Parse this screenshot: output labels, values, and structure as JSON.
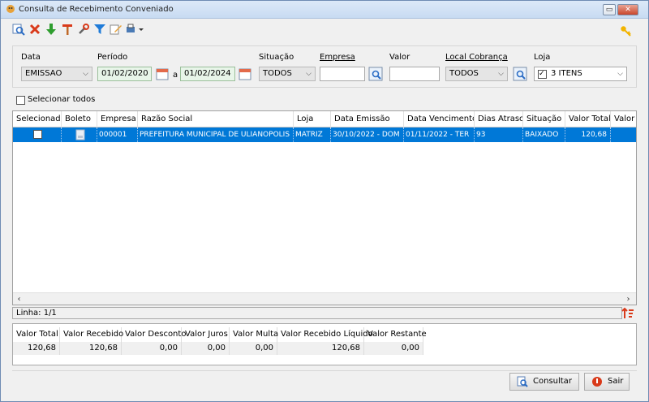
{
  "window": {
    "title": "Consulta de Recebimento Conveniado",
    "minimize": "▭",
    "close": "✕"
  },
  "filters": {
    "data_label": "Data",
    "data_value": "EMISSAO",
    "periodo_label": "Período",
    "periodo_start": "01/02/2020",
    "periodo_sep": "a",
    "periodo_end": "01/02/2024",
    "situacao_label": "Situação",
    "situacao_value": "TODOS",
    "empresa_label": "Empresa",
    "empresa_value": "",
    "valor_label": "Valor",
    "valor_value": "",
    "local_label": "Local Cobrança",
    "local_value": "TODOS",
    "loja_label": "Loja",
    "loja_value": "3 ITENS"
  },
  "select_all_label": "Selecionar todos",
  "grid": {
    "columns": [
      "Selecionado",
      "Boleto",
      "Empresa",
      "Razão Social",
      "Loja",
      "Data Emissão",
      "Data Vencimento",
      "Dias Atraso",
      "Situação",
      "Valor Total",
      "Valor"
    ],
    "rows": [
      {
        "selecionado": false,
        "empresa": "000001",
        "razao": "PREFEITURA MUNICIPAL DE ULIANOPOLIS",
        "loja": "MATRIZ",
        "emissao": "30/10/2022 - DOM",
        "vencimento": "01/11/2022 - TER",
        "dias": "93",
        "situacao": "BAIXADO",
        "valor_total": "120,68"
      }
    ]
  },
  "linha": "Linha: 1/1",
  "totals": {
    "headers": [
      "Valor Total",
      "Valor Recebido",
      "Valor Desconto",
      "Valor Juros",
      "Valor Multa",
      "Valor Recebido Líquido",
      "Valor Restante"
    ],
    "values": [
      "120,68",
      "120,68",
      "0,00",
      "0,00",
      "0,00",
      "120,68",
      "0,00"
    ]
  },
  "buttons": {
    "consultar": "Consultar",
    "sair": "Sair"
  },
  "icons": [
    "search-icon",
    "delete-icon",
    "download-icon",
    "tools-icon",
    "wrench-icon",
    "filter-icon",
    "edit-icon",
    "print-icon",
    "key-icon",
    "calendar-icon",
    "sort-icon",
    "stop-icon"
  ],
  "colors": {
    "selection": "#0078d7",
    "accent_red": "#d93a1a",
    "accent_green": "#2e9d2e"
  }
}
